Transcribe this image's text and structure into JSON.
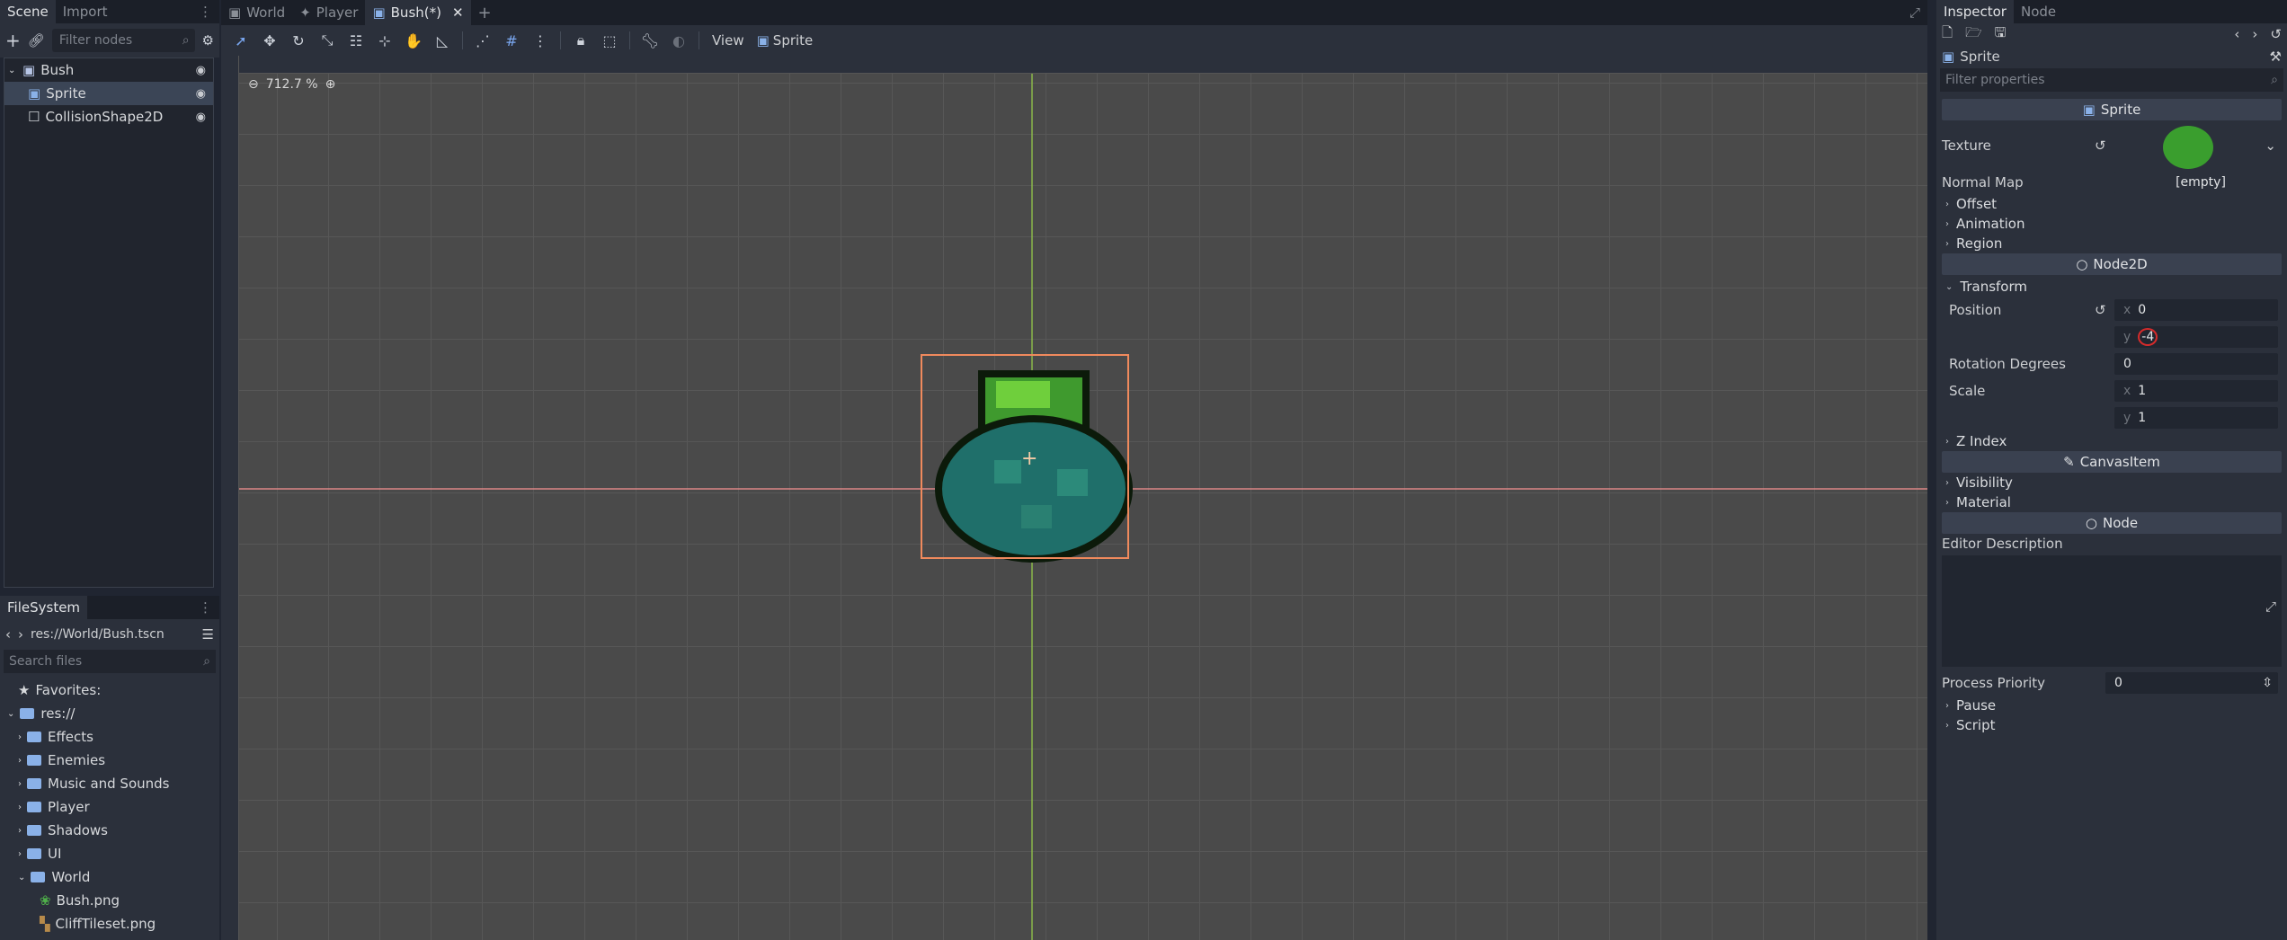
{
  "left_dock": {
    "tabs": [
      "Scene",
      "Import"
    ],
    "filter_placeholder": "Filter nodes",
    "nodes": [
      "Bush",
      "Sprite",
      "CollisionShape2D"
    ]
  },
  "filesystem": {
    "tab": "FileSystem",
    "path": "res://World/Bush.tscn",
    "search_placeholder": "Search files",
    "favorites": "Favorites:",
    "root": "res://",
    "folders": [
      "Effects",
      "Enemies",
      "Music and Sounds",
      "Player",
      "Shadows",
      "UI",
      "World"
    ],
    "world_files": [
      "Bush.png",
      "CliffTileset.png"
    ]
  },
  "editor": {
    "tabs": [
      "World",
      "Player",
      "Bush(*)"
    ],
    "zoom": "712.7 %",
    "menu_view": "View",
    "menu_sprite": "Sprite"
  },
  "inspector": {
    "tabs": [
      "Inspector",
      "Node"
    ],
    "node_name": "Sprite",
    "filter_placeholder": "Filter properties",
    "section_sprite": "Sprite",
    "texture_label": "Texture",
    "normal_map_label": "Normal Map",
    "normal_map_value": "[empty]",
    "groups1": [
      "Offset",
      "Animation",
      "Region"
    ],
    "section_node2d": "Node2D",
    "transform": "Transform",
    "position_label": "Position",
    "pos_x": "0",
    "pos_y": "-4",
    "rotation_label": "Rotation Degrees",
    "rotation_value": "0",
    "scale_label": "Scale",
    "scale_x": "1",
    "scale_y": "1",
    "z_index": "Z Index",
    "section_canvas": "CanvasItem",
    "groups2": [
      "Visibility",
      "Material"
    ],
    "section_node": "Node",
    "editor_desc": "Editor Description",
    "process_priority_label": "Process Priority",
    "process_priority_value": "0",
    "groups3": [
      "Pause",
      "Script"
    ]
  },
  "colors": {
    "accent": "#7aa7f0",
    "selection": "#f08a5d",
    "axis_y": "#8fbf4a",
    "axis_x": "#e58a8a",
    "marker": "#d52b2b"
  }
}
